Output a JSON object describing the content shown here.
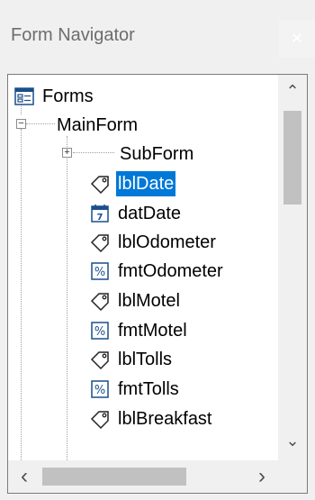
{
  "window": {
    "title": "Form Navigator",
    "close_glyph": "✕"
  },
  "tree": {
    "items": [
      {
        "label": "Forms",
        "icon": "forms-icon"
      },
      {
        "label": "MainForm",
        "icon": ""
      },
      {
        "label": "SubForm",
        "icon": ""
      },
      {
        "label": "lblDate",
        "icon": "label-tag-icon",
        "selected": true
      },
      {
        "label": "datDate",
        "icon": "date-field-icon"
      },
      {
        "label": "lblOdometer",
        "icon": "label-tag-icon"
      },
      {
        "label": "fmtOdometer",
        "icon": "formatted-field-icon"
      },
      {
        "label": "lblMotel",
        "icon": "label-tag-icon"
      },
      {
        "label": "fmtMotel",
        "icon": "formatted-field-icon"
      },
      {
        "label": "lblTolls",
        "icon": "label-tag-icon"
      },
      {
        "label": "fmtTolls",
        "icon": "formatted-field-icon"
      },
      {
        "label": "lblBreakfast",
        "icon": "label-tag-icon"
      }
    ]
  },
  "scrollbars": {
    "up": "⌃",
    "down": "⌄",
    "left": "‹",
    "right": "›"
  },
  "colors": {
    "selection": "#0078d7",
    "accent_icon": "#1a4f8a"
  }
}
